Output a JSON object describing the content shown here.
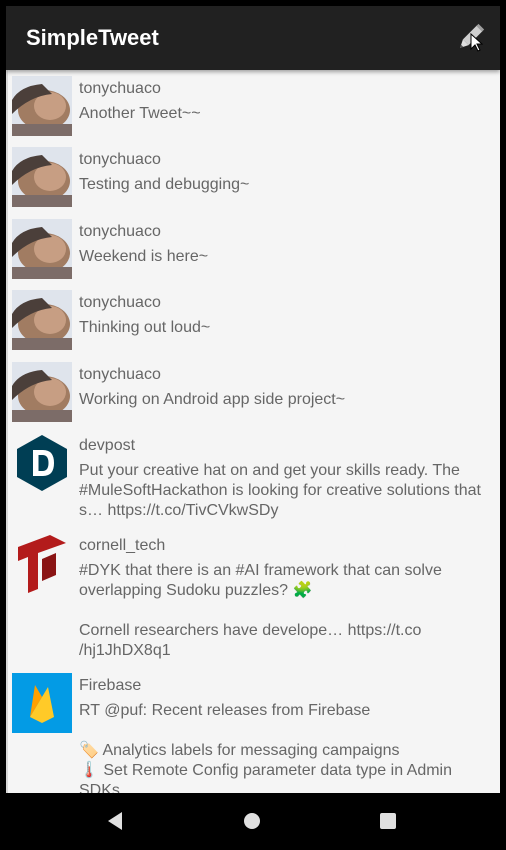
{
  "app": {
    "title": "SimpleTweet"
  },
  "tweets": [
    {
      "handle": "tonychuaco",
      "text": "Another Tweet~~",
      "avatar": "tonychuaco-avatar"
    },
    {
      "handle": "tonychuaco",
      "text": "Testing and debugging~",
      "avatar": "tonychuaco-avatar"
    },
    {
      "handle": "tonychuaco",
      "text": "Weekend is here~",
      "avatar": "tonychuaco-avatar"
    },
    {
      "handle": "tonychuaco",
      "text": "Thinking out loud~",
      "avatar": "tonychuaco-avatar"
    },
    {
      "handle": "tonychuaco",
      "text": "Working on Android app side project~",
      "avatar": "tonychuaco-avatar"
    },
    {
      "handle": "devpost",
      "text": "Put your creative hat on and get your skills ready. The #MuleSoftHackathon is looking for creative solutions that s… https://t.co/TivCVkwSDy",
      "avatar": "devpost-logo"
    },
    {
      "handle": "cornell_tech",
      "text": "#DYK that there is an #AI framework that can solve overlapping Sudoku puzzles? 🧩\n\nCornell researchers have develope… https://t.co\n/hj1JhDX8q1",
      "avatar": "cornell-tech-logo"
    },
    {
      "handle": "Firebase",
      "text": "RT @puf: Recent releases from Firebase\n\n🏷️ Analytics labels for messaging campaigns\n🌡️ Set Remote Config parameter data type in Admin SDKs",
      "avatar": "firebase-logo"
    }
  ],
  "colors": {
    "appbar": "#212121",
    "background": "#f5f5f5",
    "devpost": "#003e54",
    "cornell": "#b31b1b",
    "firebase": "#039be5"
  }
}
